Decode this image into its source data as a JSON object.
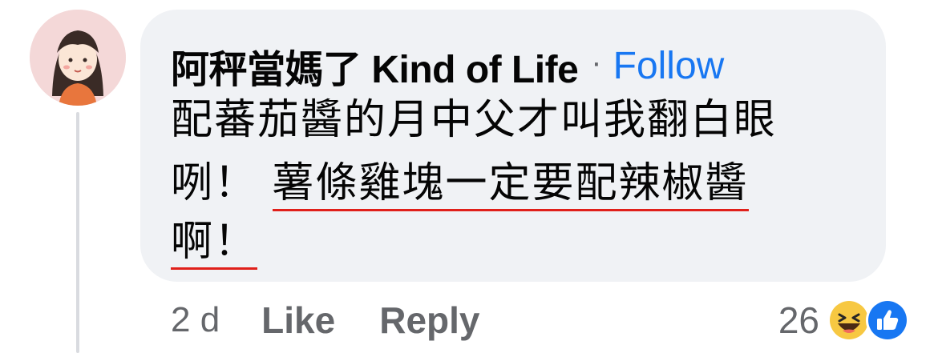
{
  "comment": {
    "author": "阿秤當媽了 Kind of Life",
    "separator": "·",
    "follow_label": "Follow",
    "text_lines": [
      "配蕃茄醬的月中父才叫我翻白眼",
      "咧！",
      "薯條雞塊一定要配辣椒醬",
      "啊！"
    ],
    "time": "2 d",
    "like_label": "Like",
    "reply_label": "Reply",
    "reaction_count": "26",
    "reactions": [
      "haha-icon",
      "like-icon"
    ]
  },
  "colors": {
    "bubble": "#f0f2f5",
    "follow": "#1877f2",
    "underline": "#e0201a",
    "meta": "#65676b"
  }
}
